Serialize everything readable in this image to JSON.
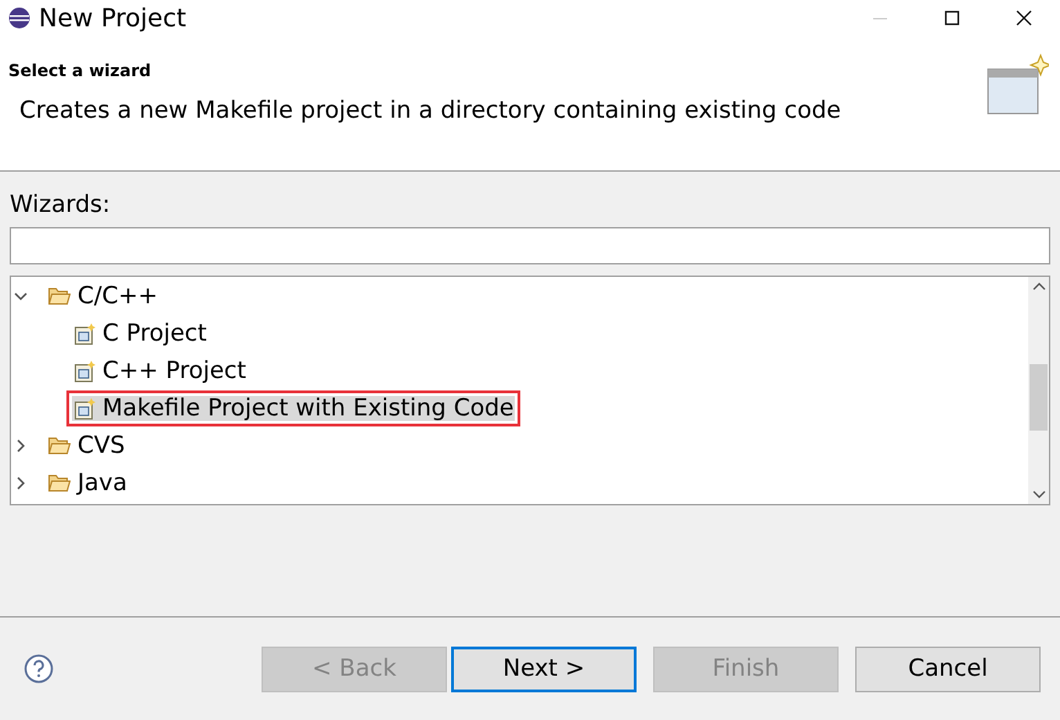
{
  "window": {
    "title": "New Project"
  },
  "header": {
    "title": "Select a wizard",
    "description": "Creates a new Makefile project in a directory containing existing code"
  },
  "wizards": {
    "label": "Wizards:",
    "tree": [
      {
        "label": "C/C++",
        "kind": "folder",
        "expanded": true,
        "selected": false,
        "children": [
          {
            "label": "C Project",
            "kind": "project",
            "selected": false,
            "highlighted": false
          },
          {
            "label": "C++ Project",
            "kind": "project",
            "selected": false,
            "highlighted": false
          },
          {
            "label": "Makefile Project with Existing Code",
            "kind": "project",
            "selected": true,
            "highlighted": true
          }
        ]
      },
      {
        "label": "CVS",
        "kind": "folder",
        "expanded": false,
        "selected": false
      },
      {
        "label": "Java",
        "kind": "folder",
        "expanded": false,
        "selected": false
      }
    ]
  },
  "buttons": [
    {
      "label": "< Back",
      "disabled": true,
      "default": false
    },
    {
      "label": "Next >",
      "disabled": false,
      "default": true
    },
    {
      "label": "Finish",
      "disabled": true,
      "default": false
    },
    {
      "label": "Cancel",
      "disabled": false,
      "default": false
    }
  ]
}
